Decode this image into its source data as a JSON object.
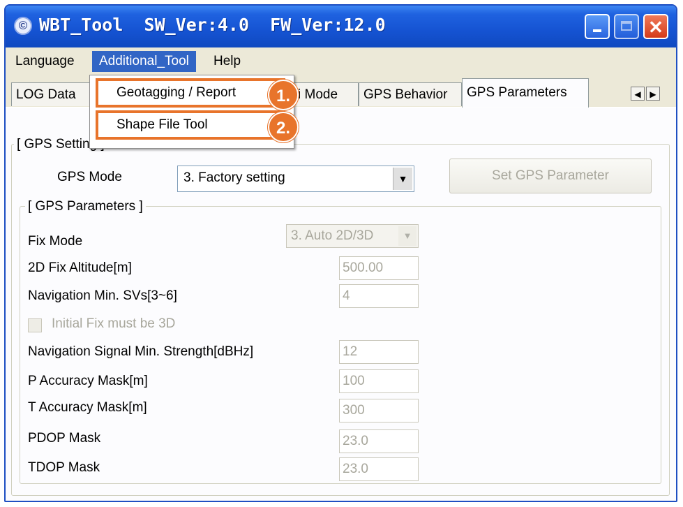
{
  "window": {
    "title": "WBT_Tool  SW_Ver:4.0  FW_Ver:12.0",
    "icon": "app-logo-icon",
    "controls": {
      "close_glyph": "✕"
    }
  },
  "menu": {
    "language": "Language",
    "additional_tool": "Additional_Tool",
    "help": "Help"
  },
  "dropdown": {
    "items": [
      {
        "label": "Geotagging / Report",
        "badge": "1."
      },
      {
        "label": "Shape File Tool",
        "badge": "2."
      }
    ]
  },
  "tabs": {
    "log": "LOG Data",
    "mode_partial": "i Mode",
    "behavior": "GPS Behavior",
    "params": "GPS Parameters",
    "scroll_left": "◀",
    "scroll_right": "▶"
  },
  "gps_setting": {
    "legend": "[ GPS Setting ]",
    "mode_label": "GPS Mode",
    "mode_value": "3. Factory setting",
    "arrow": "▼",
    "set_button": "Set GPS Parameter"
  },
  "gps_params": {
    "legend": "[ GPS Parameters ]",
    "fix_mode_label": "Fix Mode",
    "fix_mode_value": "3. Auto 2D/3D",
    "fix_alt_label": "2D Fix Altitude[m]",
    "fix_alt_value": "500.00",
    "nav_sv_label": "Navigation Min. SVs[3~6]",
    "nav_sv_value": "4",
    "initial_fix_label": "Initial Fix must be 3D",
    "signal_label": "Navigation Signal Min. Strength[dBHz]",
    "signal_value": "12",
    "p_acc_label": "P Accuracy Mask[m]",
    "p_acc_value": "100",
    "t_acc_label": "T Accuracy Mask[m]",
    "t_acc_value": "300",
    "pdop_label": "PDOP Mask",
    "pdop_value": "23.0",
    "tdop_label": "TDOP Mask",
    "tdop_value": "23.0"
  },
  "colors": {
    "title_bar": "#1553d2",
    "menu_highlight": "#3165c5",
    "annotation": "#e8742b",
    "close_button": "#d43b1a"
  }
}
